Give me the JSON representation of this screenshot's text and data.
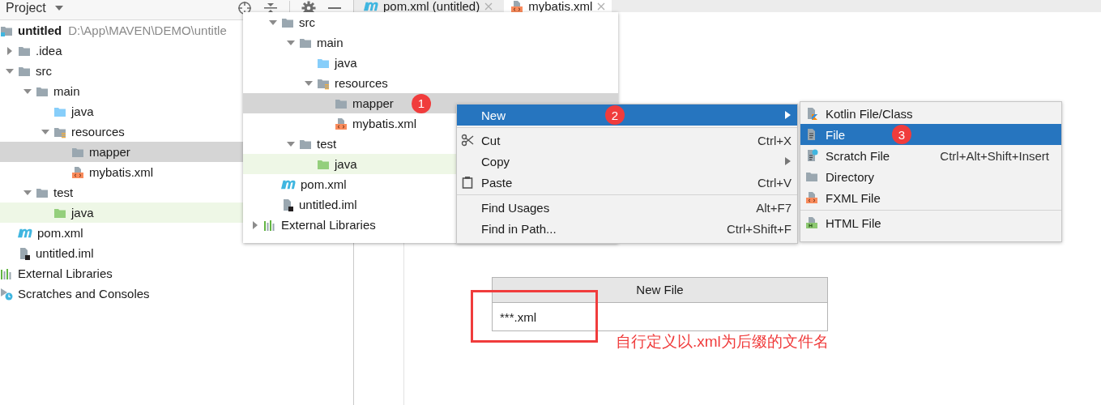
{
  "left_panel": {
    "title": "Project"
  },
  "left_tree": {
    "items": [
      {
        "label": "untitled",
        "path": "D:\\App\\MAVEN\\DEMO\\untitle",
        "kind": "module",
        "selected": false,
        "highlighted": false,
        "children": [
          {
            "label": ".idea",
            "kind": "folder",
            "expanded": false,
            "selected": false,
            "highlighted": false
          },
          {
            "label": "src",
            "kind": "folder",
            "expanded": true,
            "selected": false,
            "highlighted": false,
            "children": [
              {
                "label": "main",
                "kind": "folder",
                "expanded": true,
                "selected": false,
                "highlighted": false,
                "children": [
                  {
                    "label": "java",
                    "kind": "source",
                    "selected": false,
                    "highlighted": false
                  },
                  {
                    "label": "resources",
                    "kind": "resources",
                    "expanded": true,
                    "selected": false,
                    "highlighted": false,
                    "children": [
                      {
                        "label": "mapper",
                        "kind": "folder",
                        "selected": true,
                        "highlighted": false
                      },
                      {
                        "label": "mybatis.xml",
                        "kind": "xml",
                        "selected": false,
                        "highlighted": false
                      }
                    ]
                  }
                ]
              },
              {
                "label": "test",
                "kind": "folder",
                "expanded": true,
                "selected": false,
                "highlighted": false,
                "children": [
                  {
                    "label": "java",
                    "kind": "test",
                    "selected": false,
                    "highlighted": true
                  }
                ]
              }
            ]
          },
          {
            "label": "pom.xml",
            "kind": "maven",
            "selected": false,
            "highlighted": false
          },
          {
            "label": "untitled.iml",
            "kind": "iml",
            "selected": false,
            "highlighted": false
          }
        ]
      },
      {
        "label": "External Libraries",
        "kind": "libraries",
        "selected": false,
        "highlighted": false
      },
      {
        "label": "Scratches and Consoles",
        "kind": "scratches",
        "selected": false,
        "highlighted": false
      }
    ]
  },
  "editor_tabs": [
    {
      "label": "pom.xml (untitled)",
      "kind": "maven",
      "selected": false
    },
    {
      "label": "mybatis.xml",
      "kind": "xml",
      "selected": true
    }
  ],
  "popup_tree": {
    "project_items": [
      {
        "label": "src",
        "kind": "folder",
        "expanded": true,
        "selected": false,
        "highlighted": false,
        "children": [
          {
            "label": "main",
            "kind": "folder",
            "expanded": true,
            "selected": false,
            "highlighted": false,
            "children": [
              {
                "label": "java",
                "kind": "source",
                "selected": false,
                "highlighted": false
              },
              {
                "label": "resources",
                "kind": "resources",
                "expanded": true,
                "selected": false,
                "highlighted": false,
                "children": [
                  {
                    "label": "mapper",
                    "kind": "folder",
                    "selected": true,
                    "highlighted": false,
                    "badge": "1"
                  },
                  {
                    "label": "mybatis.xml",
                    "kind": "xml",
                    "selected": false,
                    "highlighted": false
                  }
                ]
              }
            ]
          },
          {
            "label": "test",
            "kind": "folder",
            "expanded": true,
            "selected": false,
            "highlighted": false,
            "children": [
              {
                "label": "java",
                "kind": "test",
                "selected": false,
                "highlighted": true
              }
            ]
          }
        ]
      },
      {
        "label": "pom.xml",
        "kind": "maven",
        "selected": false,
        "highlighted": false
      },
      {
        "label": "untitled.iml",
        "kind": "iml",
        "selected": false,
        "highlighted": false
      }
    ],
    "root_items": [
      {
        "label": "External Libraries",
        "kind": "libraries",
        "expanded": false,
        "selected": false,
        "highlighted": false
      }
    ]
  },
  "context_menu": {
    "items": [
      {
        "kind": "plain",
        "label": "New",
        "selected": true,
        "submenu": true,
        "badge": "2"
      },
      {
        "kind": "separator"
      },
      {
        "kind": "cut",
        "label": "Cut",
        "shortcut": "Ctrl+X",
        "selected": false,
        "submenu": false
      },
      {
        "kind": "plain",
        "label": "Copy",
        "selected": false,
        "submenu": true
      },
      {
        "kind": "paste",
        "label": "Paste",
        "shortcut": "Ctrl+V",
        "selected": false,
        "submenu": false
      },
      {
        "kind": "separator"
      },
      {
        "kind": "plain",
        "label": "Find Usages",
        "shortcut": "Alt+F7",
        "selected": false,
        "submenu": false
      },
      {
        "kind": "plain",
        "label": "Find in Path...",
        "shortcut": "Ctrl+Shift+F",
        "selected": false,
        "submenu": false
      }
    ]
  },
  "new_submenu": {
    "items": [
      {
        "kind": "kotlin",
        "label": "Kotlin File/Class",
        "selected": false
      },
      {
        "kind": "file",
        "label": "File",
        "selected": true,
        "badge": "3"
      },
      {
        "kind": "scratch",
        "label": "Scratch File",
        "shortcut": "Ctrl+Alt+Shift+Insert",
        "selected": false
      },
      {
        "kind": "folder",
        "label": "Directory",
        "selected": false
      },
      {
        "kind": "xml",
        "label": "FXML File",
        "selected": false
      },
      {
        "kind": "separator"
      },
      {
        "kind": "html",
        "label": "HTML File",
        "selected": false
      }
    ]
  },
  "new_file_dialog": {
    "title": "New File",
    "value": "***.xml"
  },
  "annotation": {
    "text": "自行定义以.xml为后缀的文件名"
  }
}
